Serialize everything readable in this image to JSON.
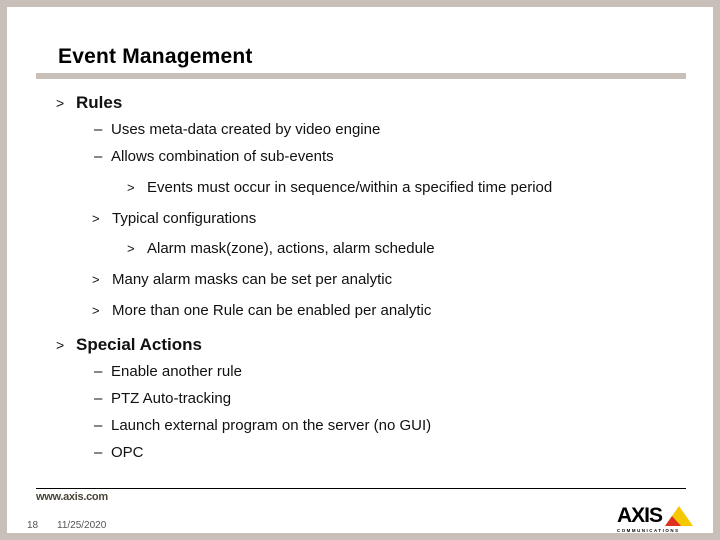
{
  "slide": {
    "title": "Event Management",
    "sections": [
      {
        "heading": "Rules",
        "bullet": ">",
        "items": [
          {
            "bullet": "–",
            "text": "Uses meta-data created by video engine"
          },
          {
            "bullet": "–",
            "text": "Allows combination of sub-events"
          },
          {
            "bullet": ">",
            "text": "Events must occur in sequence/within a specified time period",
            "level": 3
          },
          {
            "bullet": ">",
            "text": "Typical configurations"
          },
          {
            "bullet": ">",
            "text": "Alarm mask(zone), actions, alarm schedule",
            "level": 3
          },
          {
            "bullet": ">",
            "text": "Many alarm masks can be set per analytic"
          },
          {
            "bullet": ">",
            "text": "More than one Rule can be enabled per analytic"
          }
        ]
      },
      {
        "heading": "Special Actions",
        "bullet": ">",
        "items": [
          {
            "bullet": "–",
            "text": "Enable another rule"
          },
          {
            "bullet": "–",
            "text": "PTZ Auto-tracking"
          },
          {
            "bullet": "–",
            "text": "Launch external program on the server (no GUI)"
          },
          {
            "bullet": "–",
            "text": "OPC"
          }
        ]
      }
    ]
  },
  "footer": {
    "url": "www.axis.com",
    "page_number": "18",
    "date": "11/25/2020",
    "logo_text": "AXIS",
    "logo_subtext": "COMMUNICATIONS"
  },
  "colors": {
    "border": "#c8c0b8",
    "logo_yellow": "#f5c800",
    "logo_red": "#e03020"
  }
}
